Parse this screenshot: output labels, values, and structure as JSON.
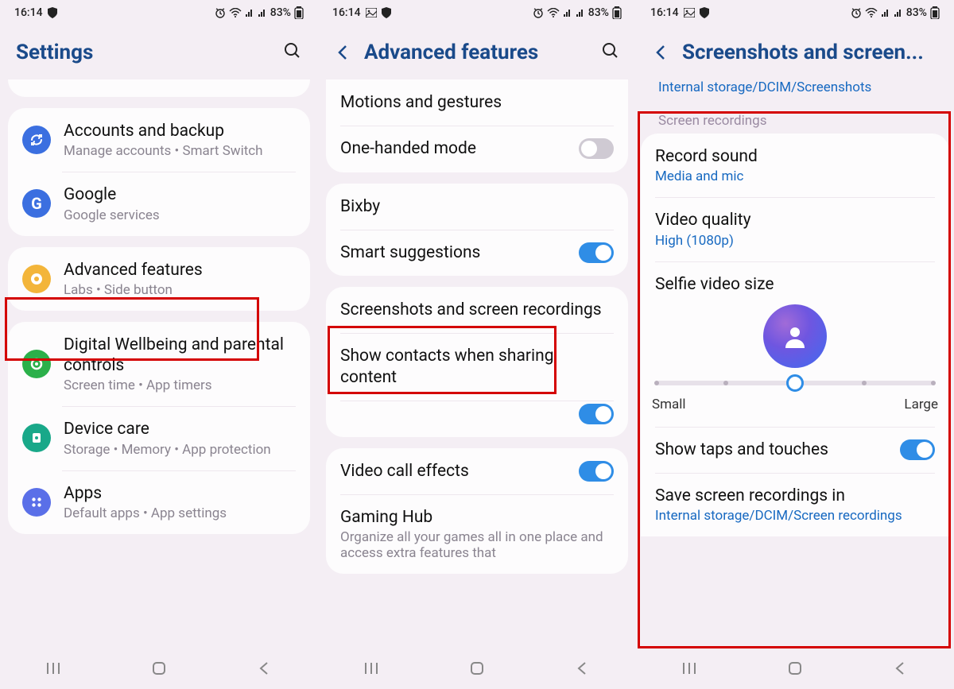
{
  "status": {
    "time": "16:14",
    "battery": "83%"
  },
  "phone1": {
    "title": "Settings",
    "items": {
      "accounts": {
        "title": "Accounts and backup",
        "sub": "Manage accounts  •  Smart Switch"
      },
      "google": {
        "title": "Google",
        "sub": "Google services"
      },
      "advanced": {
        "title": "Advanced features",
        "sub": "Labs  •  Side button"
      },
      "wellbeing": {
        "title": "Digital Wellbeing and parental controls",
        "sub": "Screen time  •  App timers"
      },
      "devicecare": {
        "title": "Device care",
        "sub": "Storage  •  Memory  •  App protection"
      },
      "apps": {
        "title": "Apps",
        "sub": "Default apps  •  App settings"
      }
    }
  },
  "phone2": {
    "title": "Advanced features",
    "items": {
      "motions": {
        "title": "Motions and gestures"
      },
      "onehand": {
        "title": "One-handed mode"
      },
      "bixby": {
        "title": "Bixby"
      },
      "smart": {
        "title": "Smart suggestions"
      },
      "screenshots": {
        "title": "Screenshots and screen recordings"
      },
      "showcontacts": {
        "title": "Show contacts when sharing content"
      },
      "videocall": {
        "title": "Video call effects"
      },
      "gaminghub": {
        "title": "Gaming Hub",
        "sub": "Organize all your games all in one place and access extra features that"
      }
    }
  },
  "phone3": {
    "title": "Screenshots and screen...",
    "peek": "Internal storage/DCIM/Screenshots",
    "section": "Screen recordings",
    "items": {
      "recordsound": {
        "title": "Record sound",
        "value": "Media and mic"
      },
      "videoquality": {
        "title": "Video quality",
        "value": "High (1080p)"
      },
      "selfiesize": {
        "title": "Selfie video size"
      },
      "slider": {
        "small": "Small",
        "large": "Large"
      },
      "showtaps": {
        "title": "Show taps and touches"
      },
      "savepath": {
        "title": "Save screen recordings in",
        "value": "Internal storage/DCIM/Screen recordings"
      }
    }
  },
  "icon_colors": {
    "accounts": "#3b6fe0",
    "google": "#3b6fe0",
    "advanced": "#f3b53a",
    "wellbeing": "#2bb04a",
    "devicecare": "#19a889",
    "apps": "#5a6fe8"
  }
}
